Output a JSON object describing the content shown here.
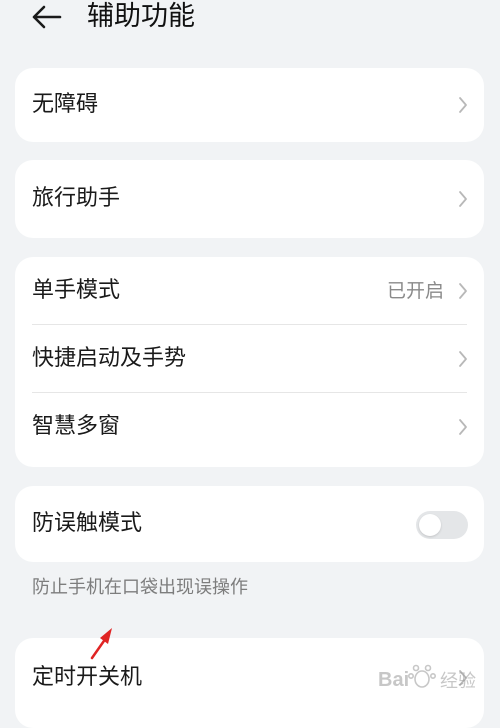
{
  "header": {
    "title": "辅助功能",
    "back_icon": "arrow-left-icon"
  },
  "cards": [
    {
      "items": [
        {
          "label": "无障碍",
          "value": ""
        }
      ]
    },
    {
      "items": [
        {
          "label": "旅行助手",
          "value": ""
        }
      ]
    },
    {
      "items": [
        {
          "label": "单手模式",
          "value": "已开启"
        },
        {
          "label": "快捷启动及手势",
          "value": ""
        },
        {
          "label": "智慧多窗",
          "value": ""
        }
      ]
    },
    {
      "items": [
        {
          "label": "防误触模式",
          "toggle": false
        }
      ]
    },
    {
      "items": [
        {
          "label": "定时开关机",
          "value": ""
        }
      ]
    }
  ],
  "hint": "防止手机在口袋出现误操作",
  "watermark": {
    "text": "Bai经验",
    "brand_color": "#cc2a2a"
  },
  "colors": {
    "background": "#f1f3f5",
    "card": "#ffffff",
    "annotation_arrow": "#e02424"
  }
}
